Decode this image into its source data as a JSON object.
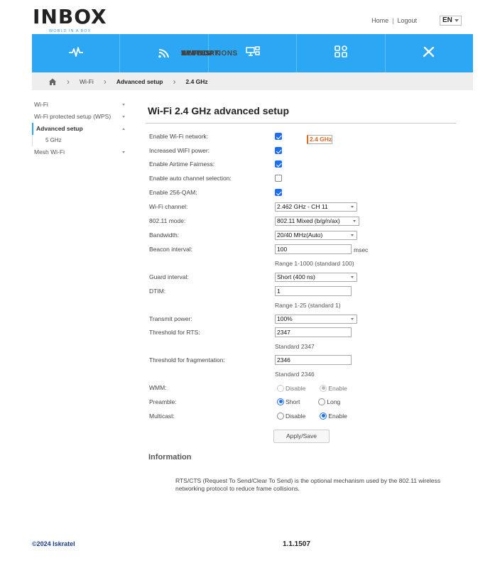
{
  "brand": {
    "logo_text": "INBOX",
    "tagline": "WORLD IN A BOX"
  },
  "toplinks": {
    "home": "Home",
    "separator": "|",
    "logout": "Logout",
    "language": "EN"
  },
  "nav": [
    {
      "label": "STATUS",
      "icon": "pulse-icon"
    },
    {
      "label": "WI-FI",
      "icon": "wifi-icon"
    },
    {
      "label": "NETWORK",
      "icon": "network-icon"
    },
    {
      "label": "APPLICATIONS",
      "icon": "apps-icon"
    },
    {
      "label": "SYSTEM",
      "icon": "tools-icon"
    }
  ],
  "breadcrumb": {
    "items": [
      "Wi-Fi",
      "Advanced setup",
      "2.4 GHz"
    ]
  },
  "sidebar": {
    "items": [
      {
        "label": "Wi-Fi"
      },
      {
        "label": "Wi-Fi protected setup (WPS)"
      },
      {
        "label": "Advanced setup"
      },
      {
        "label": "2.4 GHz"
      },
      {
        "label": "5 GHz"
      },
      {
        "label": "Mesh Wi-Fi"
      }
    ]
  },
  "page": {
    "title": "Wi-Fi 2.4 GHz advanced setup"
  },
  "form": {
    "enable_wifi": {
      "label": "Enable Wi-Fi network:",
      "checked": true
    },
    "increased_power": {
      "label": "Increased WiFI power:",
      "checked": true
    },
    "airtime_fairness": {
      "label": "Enable Airtime Fairness:",
      "checked": true
    },
    "auto_channel": {
      "label": "Enable auto channel selection:",
      "checked": false
    },
    "qam256": {
      "label": "Enable 256-QAM:",
      "checked": true
    },
    "channel": {
      "label": "Wi-Fi channel:",
      "value": "2.462 GHz - CH 11"
    },
    "mode": {
      "label": "802.11 mode:",
      "value": "802.11 Mixed (b/g/n/ax)"
    },
    "bandwidth": {
      "label": "Bandwidth:",
      "value": "20/40 MHz(Auto)"
    },
    "beacon": {
      "label": "Beacon interval:",
      "value": "100",
      "unit": "msec",
      "hint": "Range 1-1000 (standard 100)"
    },
    "guard": {
      "label": "Guard interval:",
      "value": "Short (400 ns)"
    },
    "dtim": {
      "label": "DTIM:",
      "value": "1",
      "hint": "Range 1-25 (standard 1)"
    },
    "tx_power": {
      "label": "Transmit power:",
      "value": "100%"
    },
    "rts": {
      "label": "Threshold for RTS:",
      "value": "2347",
      "hint": "Standard 2347"
    },
    "frag": {
      "label": "Threshold for fragmentation:",
      "value": "2346",
      "hint": "Standard 2346"
    },
    "wmm": {
      "label": "WMM:",
      "opt1": "Disable",
      "opt2": "Enable",
      "selected": "Enable",
      "disabled": true
    },
    "preamble": {
      "label": "Preamble:",
      "opt1": "Short",
      "opt2": "Long",
      "selected": "Short"
    },
    "multicast": {
      "label": "Multicast:",
      "opt1": "Disable",
      "opt2": "Enable",
      "selected": "Enable"
    },
    "apply_label": "Apply/Save"
  },
  "info": {
    "heading": "Information",
    "text": "RTS/CTS (Request To Send/Clear To Send) is the optional mechanism used by the 802.11 wireless networking protocol to reduce frame collisions."
  },
  "footer": {
    "copyright": "©2024 Iskratel",
    "version": "1.1.1507"
  },
  "colors": {
    "accent": "#2ba7f4",
    "selected": "#e8661c",
    "check": "#1d6ef5",
    "footer_link": "#1b3d8f"
  }
}
